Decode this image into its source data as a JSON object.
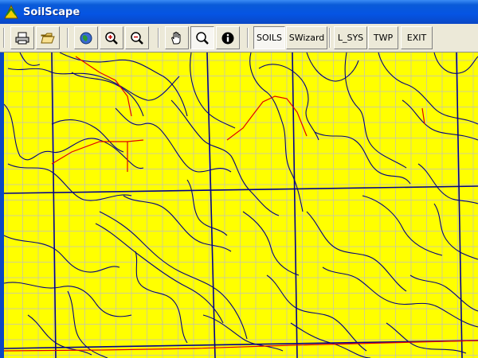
{
  "window": {
    "title": "SoilScape"
  },
  "toolbar": {
    "text_buttons": {
      "soils": "SOILS",
      "swizard": "SWizard",
      "lsys": "L_SYS",
      "twp": "TWP",
      "exit": "EXIT"
    },
    "icons": [
      "print-icon",
      "open-folder-icon",
      "globe-icon",
      "zoom-in-icon",
      "zoom-out-icon",
      "pan-hand-icon",
      "select-zoom-icon",
      "info-icon"
    ],
    "selected": [
      "select-zoom-icon",
      "SOILS"
    ]
  },
  "map": {
    "background_color": "#ffff00",
    "grid_color": "#c0c0c0",
    "section_line_color": "#00008b",
    "soil_boundary_color": "#000080",
    "road_color": "#ff0000"
  }
}
